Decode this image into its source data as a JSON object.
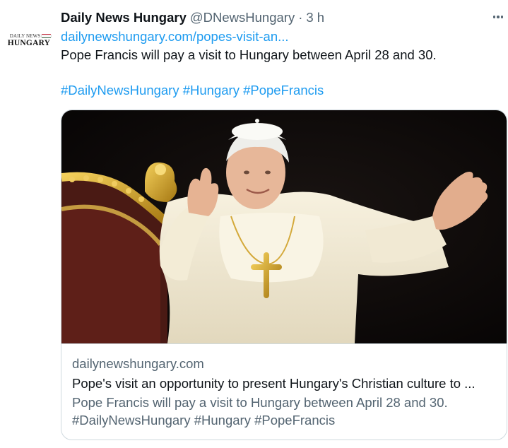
{
  "account": {
    "display_name": "Daily News Hungary",
    "handle": "@DNewsHungary",
    "separator": "·",
    "time": "3 h",
    "avatar_logo": {
      "top_text": "DAILY NEWS",
      "main_text": "HUNGARY",
      "flag_colors": [
        "#cd2a3e",
        "#ffffff",
        "#436f4d"
      ]
    }
  },
  "tweet": {
    "link": "dailynewshungary.com/popes-visit-an...",
    "text": "Pope Francis will pay a visit to Hungary between April 28 and 30.",
    "hashtags": [
      "#DailyNewsHungary",
      "#Hungary",
      "#PopeFrancis"
    ]
  },
  "card": {
    "domain": "dailynewshungary.com",
    "title": "Pope's visit an opportunity to present Hungary's Christian culture to ...",
    "description": "Pope Francis will pay a visit to Hungary between April 28 and 30.",
    "hashtags": "#DailyNewsHungary #Hungary #PopeFrancis"
  },
  "icons": {
    "more": "more-horizontal-icon"
  },
  "colors": {
    "text_primary": "#0f1419",
    "text_secondary": "#536471",
    "accent": "#1d9bf0",
    "border": "#cfd9de"
  }
}
